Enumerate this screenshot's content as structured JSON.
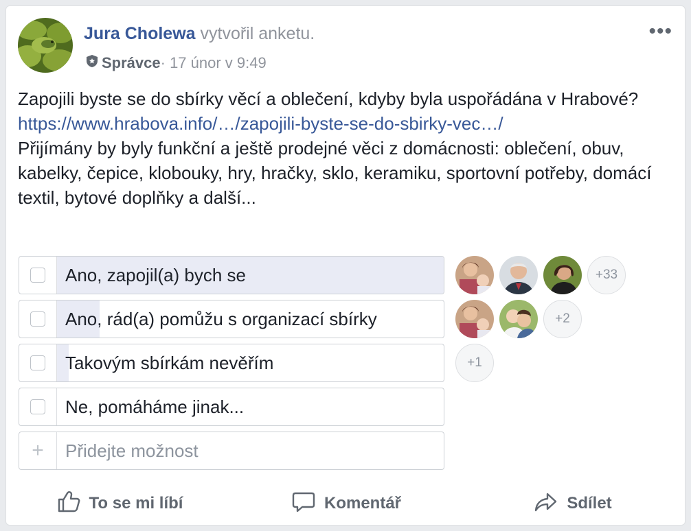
{
  "post": {
    "author": "Jura Cholewa",
    "action": " vytvořil anketu.",
    "role": "Správce",
    "timestamp": " · 17 únor v 9:49",
    "question": "Zapojili byste se do sbírky věcí a oblečení, kdyby byla uspořádána v Hrabové?",
    "link": "https://www.hrabova.info/…/zapojili-byste-se-do-sbirky-vec…/",
    "description": "Přijímány by byly funkční a ještě prodejné věci z domácnosti: oblečení, obuv, kabelky, čepice, klobouky, hry, hračky, sklo, keramiku, sportovní potřeby, domácí textil, bytové doplňky a další..."
  },
  "poll": {
    "options": [
      {
        "label": "Ano, zapojil(a) bych se",
        "fill_fraction": 1.0,
        "more": "+33"
      },
      {
        "label": "Ano, rád(a) pomůžu s organizací sbírky",
        "fill_fraction": 0.11,
        "more": "+2"
      },
      {
        "label": "Takovým sbírkám nevěřím",
        "fill_fraction": 0.03,
        "more": "+1"
      },
      {
        "label": "Ne, pomáháme jinak...",
        "fill_fraction": 0.0,
        "more": ""
      }
    ],
    "add_placeholder": "Přidejte možnost",
    "add_icon": "+"
  },
  "actions": {
    "like": "To se mi líbí",
    "comment": "Komentář",
    "share": "Sdílet"
  },
  "colors": {
    "author_link": "#385898",
    "poll_fill": "#e9ebf5",
    "action_text": "#606770"
  }
}
